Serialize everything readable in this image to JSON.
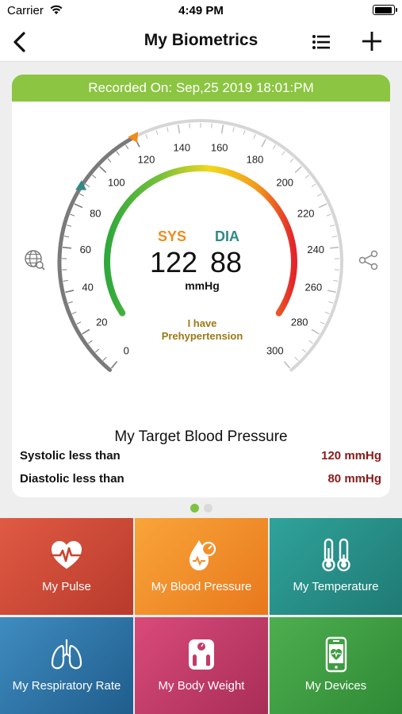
{
  "status_bar": {
    "carrier": "Carrier",
    "time": "4:49 PM"
  },
  "nav": {
    "title": "My Biometrics"
  },
  "recorded": "Recorded On: Sep,25 2019 18:01:PM",
  "gauge": {
    "scale_min": 0,
    "scale_max": 300,
    "tick_labels": [
      "0",
      "20",
      "40",
      "60",
      "80",
      "100",
      "120",
      "140",
      "160",
      "180",
      "200",
      "220",
      "240",
      "260",
      "280",
      "300"
    ],
    "systolic_marker": 120,
    "diastolic_marker": 88,
    "colors": {
      "sys_marker": "#f08c1c",
      "dia_marker": "#2f8b84",
      "scale_arc": "#7a7a7a",
      "scale_arc_light": "#d6d6d6"
    }
  },
  "reading": {
    "sys_label": "SYS",
    "dia_label": "DIA",
    "sys_value": "122",
    "dia_value": "88",
    "unit": "mmHg",
    "status_line1": "I have",
    "status_line2": "Prehypertension"
  },
  "target": {
    "title": "My Target Blood Pressure",
    "systolic_label": "Systolic less than",
    "systolic_value": "120 mmHg",
    "diastolic_label": "Diastolic less than",
    "diastolic_value": "80 mmHg"
  },
  "tiles": [
    {
      "label": "My Pulse",
      "icon": "heart-pulse-icon",
      "color": "#d24b38"
    },
    {
      "label": "My Blood Pressure",
      "icon": "blood-drop-gauge-icon",
      "color": "#f4902a"
    },
    {
      "label": "My Temperature",
      "icon": "thermometer-icon",
      "color": "#289088"
    },
    {
      "label": "My Respiratory Rate",
      "icon": "lungs-icon",
      "color": "#2f76a8"
    },
    {
      "label": "My Body Weight",
      "icon": "scale-icon",
      "color": "#c23b67"
    },
    {
      "label": "My Devices",
      "icon": "phone-device-icon",
      "color": "#3f9c43"
    }
  ]
}
